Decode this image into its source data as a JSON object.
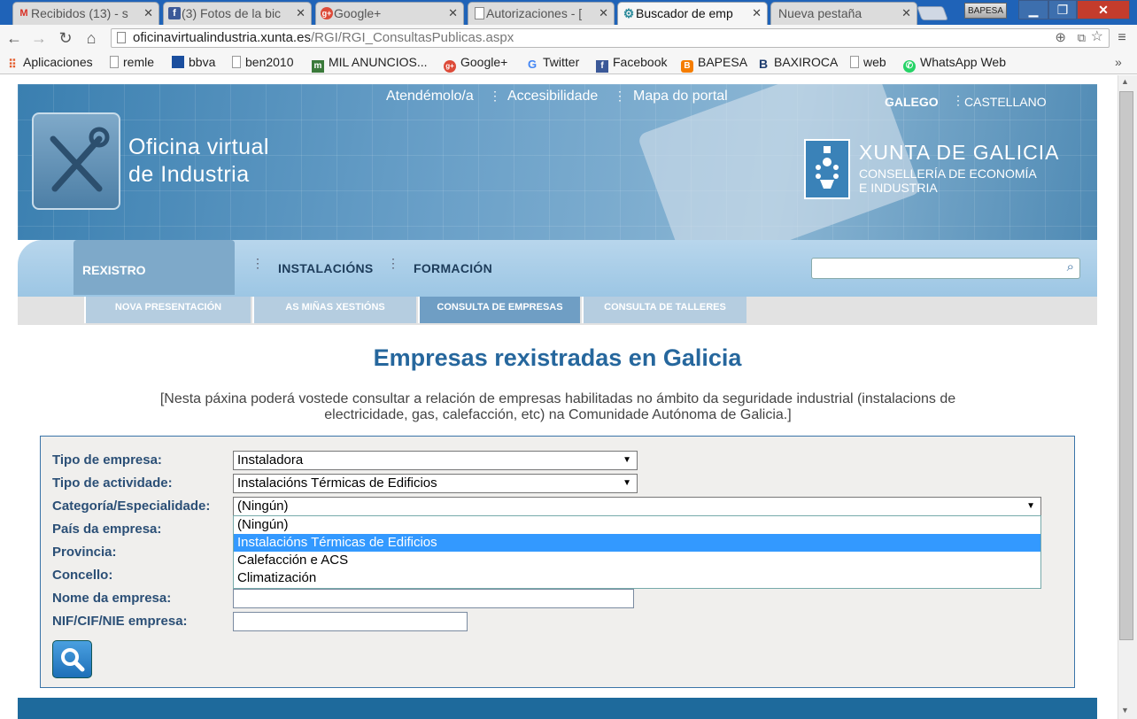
{
  "browser": {
    "tabs": [
      {
        "title": "Recibidos (13) - s",
        "icon": "M",
        "icon_color": "#d93025",
        "active": false
      },
      {
        "title": "(3) Fotos de la bic",
        "icon": "f",
        "icon_color": "#3b5998",
        "active": false
      },
      {
        "title": "Google+",
        "icon": "g+",
        "icon_color": "#dd4b39",
        "active": false
      },
      {
        "title": "Autorizaciones - [",
        "icon": "📄",
        "icon_color": "#888888",
        "active": false
      },
      {
        "title": "Buscador de emp",
        "icon": "⚙",
        "icon_color": "#2a8a9a",
        "active": true
      },
      {
        "title": "Nueva pestaña",
        "icon": "",
        "icon_color": "#888888",
        "active": false
      }
    ],
    "profile_label": "BAPESA",
    "url_host": "oficinavirtualindustria.xunta.es",
    "url_path": "/RGI/RGI_ConsultasPublicas.aspx",
    "bookmarks": [
      {
        "label": "Aplicaciones",
        "icon": "apps-icon",
        "color": "#e45b2b"
      },
      {
        "label": "remle",
        "icon": "page-icon",
        "color": "#999999"
      },
      {
        "label": "bbva",
        "icon": "bbva-icon",
        "color": "#1a4e9e"
      },
      {
        "label": "ben2010",
        "icon": "page-icon",
        "color": "#999999"
      },
      {
        "label": "MIL ANUNCIOS...",
        "icon": "m-icon",
        "color": "#3a7a3a"
      },
      {
        "label": "Google+",
        "icon": "gplus-icon",
        "color": "#dd4b39"
      },
      {
        "label": "Twitter",
        "icon": "g-icon",
        "color": "#4285f4"
      },
      {
        "label": "Facebook",
        "icon": "facebook-icon",
        "color": "#3b5998"
      },
      {
        "label": "BAPESA",
        "icon": "blogger-icon",
        "color": "#f57d00"
      },
      {
        "label": "BAXIROCA",
        "icon": "b-icon",
        "color": "#1d3c6e"
      },
      {
        "label": "web",
        "icon": "page-icon",
        "color": "#999999"
      },
      {
        "label": "WhatsApp Web",
        "icon": "whatsapp-icon",
        "color": "#25d366"
      }
    ]
  },
  "site": {
    "name_line1": "Oficina virtual",
    "name_line2": "de Industria",
    "top_links": [
      "Atendémolo/a",
      "Accesibilidade",
      "Mapa do portal"
    ],
    "lang_active": "GALEGO",
    "lang_other": "CASTELLANO",
    "org_name": "XUNTA DE GALICIA",
    "org_dept1": "CONSELLERÍA DE ECONOMÍA",
    "org_dept2": "E INDUSTRIA",
    "menu": [
      "REXISTRO",
      "INSTALACIÓNS",
      "FORMACIÓN"
    ],
    "submenu": [
      "NOVA PRESENTACIÓN",
      "AS MIÑAS XESTIÓNS",
      "CONSULTA DE EMPRESAS",
      "CONSULTA DE TALLERES"
    ],
    "submenu_active": 2
  },
  "main": {
    "title": "Empresas rexistradas en Galicia",
    "description_line1": "[Nesta páxina poderá vostede consultar a relación de empresas habilitadas no ámbito da seguridade industrial (instalacions de",
    "description_line2": "electricidade, gas, calefacción, etc) na Comunidade Autónoma de Galicia.]"
  },
  "form": {
    "labels": [
      "Tipo de empresa:",
      "Tipo de actividade:",
      "Categoría/Especialidade:",
      "País da empresa:",
      "Provincia:",
      "Concello:",
      "Nome da empresa:",
      "NIF/CIF/NIE empresa:"
    ],
    "tipo_empresa": "Instaladora",
    "tipo_actividade": "Instalacións Térmicas de Edificios",
    "categoria": "(Ningún)",
    "categoria_options": [
      "(Ningún)",
      "Instalacións Térmicas de Edificios",
      "Calefacción e ACS",
      "Climatización"
    ],
    "categoria_highlighted": 1,
    "nome_empresa": "",
    "nif": ""
  },
  "colors": {
    "accent": "#26679d",
    "label": "#2b4f76",
    "highlight": "#3399ff",
    "tabstrip": "#1f63b8"
  }
}
